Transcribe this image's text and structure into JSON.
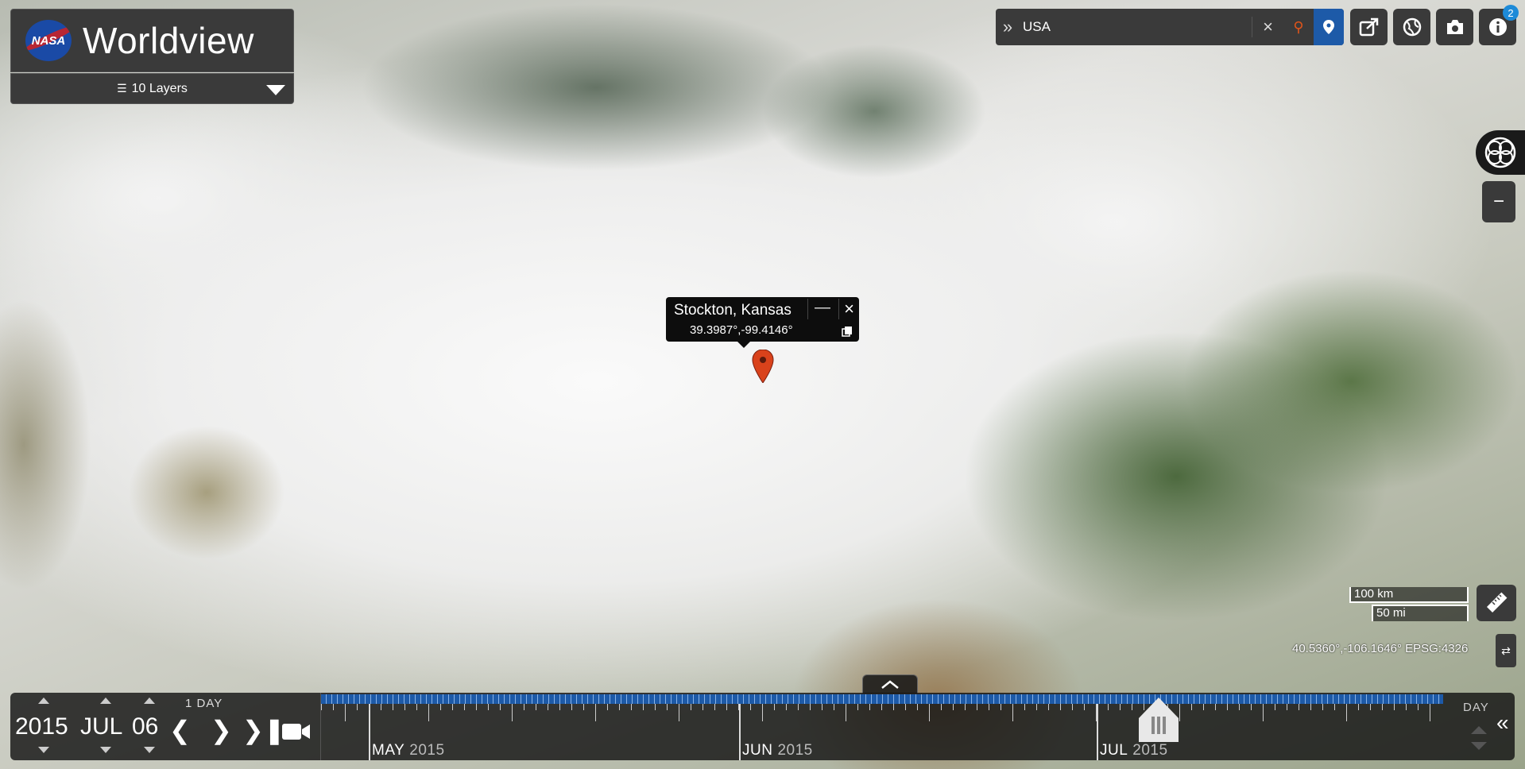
{
  "brand": {
    "logo_text": "NASA",
    "title": "Worldview"
  },
  "layers": {
    "label": "10 Layers"
  },
  "search": {
    "value": "USA"
  },
  "toolbar": {
    "notification_count": "2",
    "icons": [
      "share-icon",
      "globe-icon",
      "camera-icon",
      "info-icon"
    ]
  },
  "zoom": {
    "out_label": "−"
  },
  "popup": {
    "place": "Stockton, Kansas",
    "coords": "39.3987°,-99.4146°"
  },
  "scale": {
    "km": "100 km",
    "mi": "50 mi"
  },
  "coordinate_readout": "40.5360°,-106.1646° EPSG:4326",
  "timeline": {
    "year": "2015",
    "month": "JUL",
    "day": "06",
    "interval": "1 DAY",
    "zoom_level": "DAY",
    "months": [
      {
        "month": "MAY",
        "year": "2015"
      },
      {
        "month": "JUN",
        "year": "2015"
      },
      {
        "month": "JUL",
        "year": "2015"
      }
    ]
  }
}
